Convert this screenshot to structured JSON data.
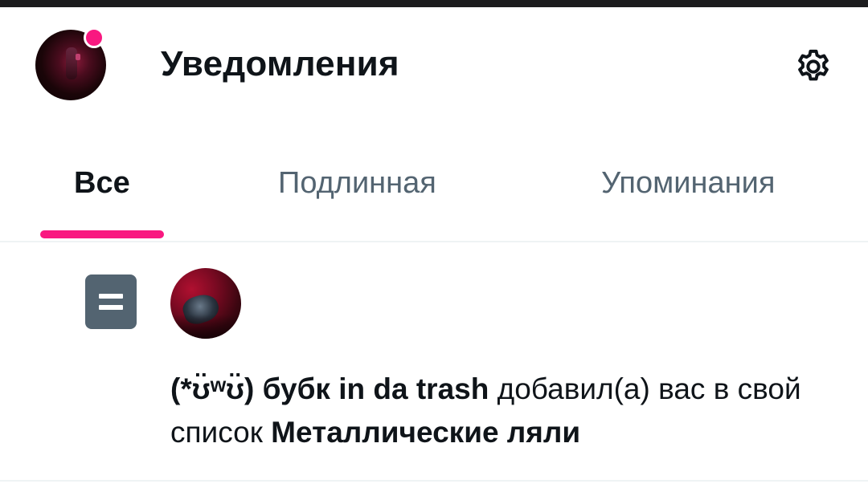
{
  "header": {
    "title": "Уведомления",
    "has_unread_dot": true,
    "accent_color": "#f91880",
    "settings_icon": "gear-icon"
  },
  "tabs": [
    {
      "label": "Все",
      "active": true
    },
    {
      "label": "Подлинная",
      "active": false
    },
    {
      "label": "Упоминания",
      "active": false
    }
  ],
  "notifications": [
    {
      "type": "list-add",
      "icon": "list-icon",
      "actor_name": "(*ʊ̈ʷʊ̈) бубк in da trash",
      "action_text": " добавил(а) вас в свой список ",
      "list_name": "Металлические ляли"
    }
  ]
}
